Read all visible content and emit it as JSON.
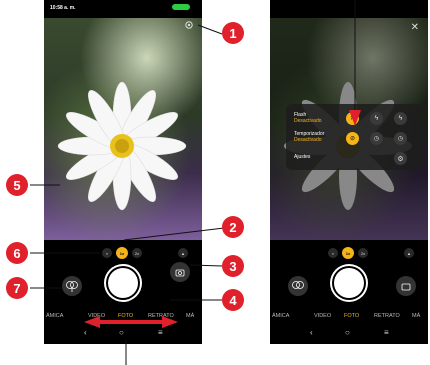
{
  "left": {
    "status_time": "10:58 a. m.",
    "zoom": [
      "1x",
      "2x"
    ],
    "modes": [
      "ÁMICA",
      "VIDEO",
      "FOTO",
      "RETRATO",
      "MÁ"
    ],
    "nav": [
      "‹",
      "○",
      "≡"
    ]
  },
  "right": {
    "panel": {
      "flash_label": "Flash",
      "flash_state": "Desactivado",
      "timer_label": "Temporizador",
      "timer_state": "Desactivado",
      "settings_label": "Ajustes"
    },
    "zoom": [
      "1x",
      "2x"
    ],
    "modes": [
      "ÁMICA",
      "VIDEO",
      "FOTO",
      "RETRATO",
      "MÁ"
    ],
    "nav": [
      "‹",
      "○",
      "≡"
    ]
  },
  "callouts": [
    "1",
    "2",
    "3",
    "4",
    "5",
    "6",
    "7"
  ],
  "colors": {
    "accent": "#f5b41a",
    "callout": "#e0202a"
  }
}
